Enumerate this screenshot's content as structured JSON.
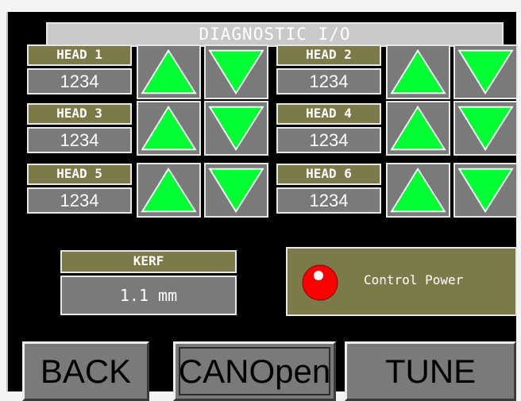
{
  "title": "DIAGNOSTIC I/O",
  "heads": [
    {
      "label": "HEAD 1",
      "value": "1234"
    },
    {
      "label": "HEAD 2",
      "value": "1234"
    },
    {
      "label": "HEAD 3",
      "value": "1234"
    },
    {
      "label": "HEAD 4",
      "value": "1234"
    },
    {
      "label": "HEAD 5",
      "value": "1234"
    },
    {
      "label": "HEAD 6",
      "value": "1234"
    }
  ],
  "kerf": {
    "label": "KERF",
    "value": "1.1 mm"
  },
  "control_power": {
    "label": "Control Power",
    "status": "off",
    "led_color": "#ff0000"
  },
  "buttons": {
    "back": "BACK",
    "canopen": "CANOpen",
    "tune": "TUNE"
  },
  "colors": {
    "arrow": "#00ff33",
    "label_bg": "#7d7a4a",
    "value_bg": "#7a7a7a"
  },
  "icons": {
    "up": "triangle-up-icon",
    "down": "triangle-down-icon"
  }
}
